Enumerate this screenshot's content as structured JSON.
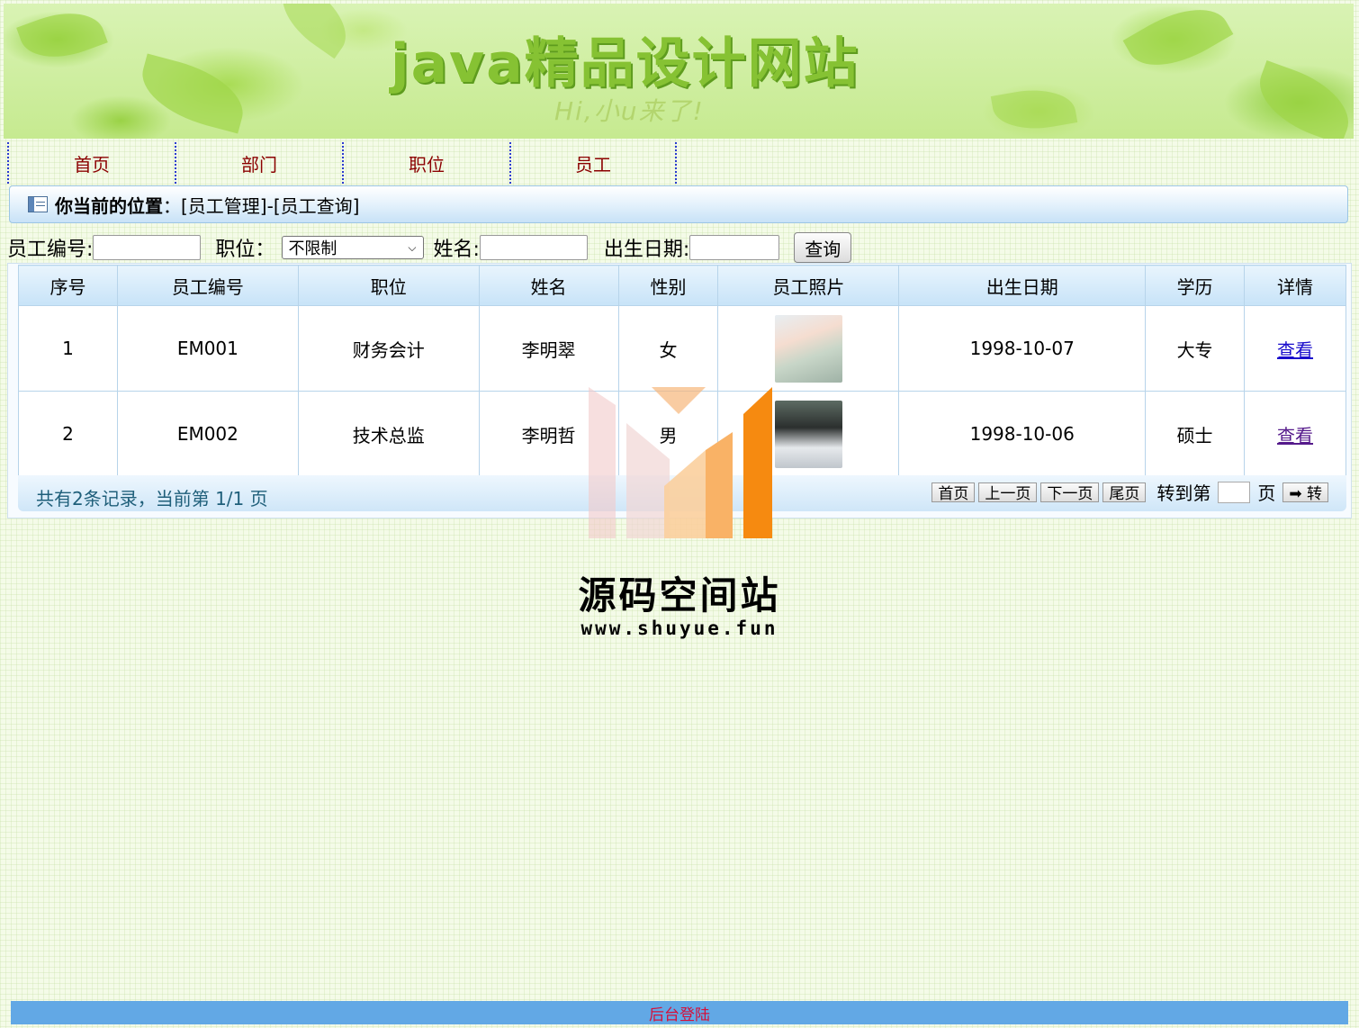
{
  "header": {
    "title": "java精品设计网站",
    "subtitle": "Hi,小u来了!"
  },
  "nav": [
    "首页",
    "部门",
    "职位",
    "员工"
  ],
  "breadcrumb": {
    "label": "你当前的位置",
    "path": "：[员工管理]-[员工查询]"
  },
  "search": {
    "emp_no_label": "员工编号:",
    "position_label": "职位：",
    "position_value": "不限制",
    "name_label": "姓名:",
    "birth_label": "出生日期:",
    "query_button": "查询"
  },
  "table": {
    "headers": [
      "序号",
      "员工编号",
      "职位",
      "姓名",
      "性别",
      "员工照片",
      "出生日期",
      "学历",
      "详情"
    ],
    "rows": [
      {
        "idx": "1",
        "no": "EM001",
        "position": "财务会计",
        "name": "李明翠",
        "gender": "女",
        "birth": "1998-10-07",
        "edu": "大专",
        "detail": "查看"
      },
      {
        "idx": "2",
        "no": "EM002",
        "position": "技术总监",
        "name": "李明哲",
        "gender": "男",
        "birth": "1998-10-06",
        "edu": "硕士",
        "detail": "查看"
      }
    ]
  },
  "pager": {
    "records": "共有2条记录，当前第 1/1 页",
    "first": "首页",
    "prev": "上一页",
    "next": "下一页",
    "last": "尾页",
    "goto_label": "转到第",
    "page_label": "页",
    "go_button": "➡ 转"
  },
  "watermark": {
    "title": "源码空间站",
    "url": "www.shuyue.fun"
  },
  "footer": {
    "admin_login": "后台登陆"
  }
}
